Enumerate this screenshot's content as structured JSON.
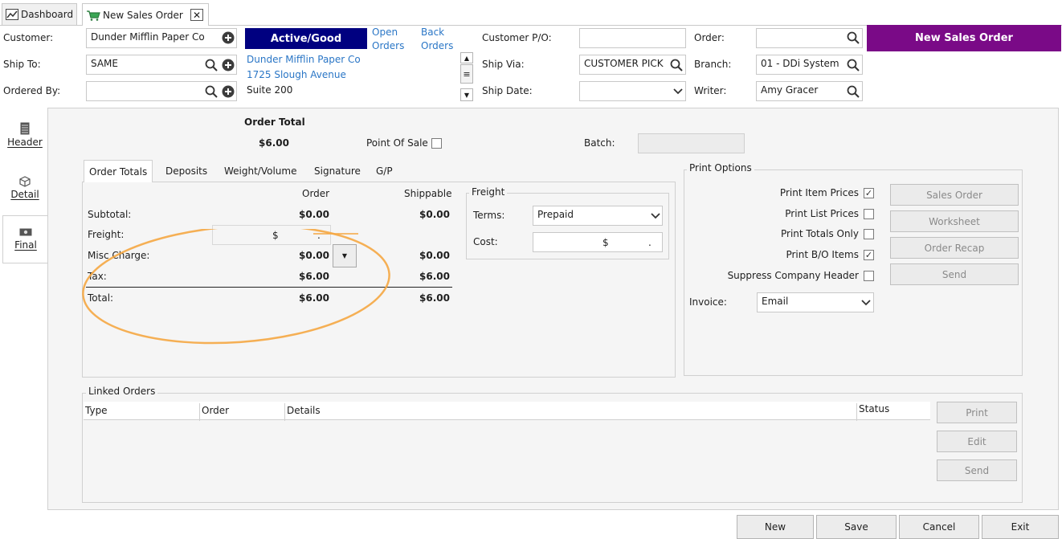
{
  "tabs": [
    {
      "label": "Dashboard"
    },
    {
      "label": "New Sales Order"
    }
  ],
  "header": {
    "customer_label": "Customer:",
    "customer_value": "Dunder Mifflin Paper Co",
    "shipto_label": "Ship To:",
    "shipto_value": "SAME",
    "orderedby_label": "Ordered By:",
    "orderedby_value": "",
    "status_badge": "Active/Good",
    "open_orders": [
      "Open",
      "Orders"
    ],
    "back_orders": [
      "Back",
      "Orders"
    ],
    "address": [
      "Dunder Mifflin Paper Co",
      "1725 Slough Avenue",
      "Suite 200"
    ],
    "customer_po_label": "Customer P/O:",
    "customer_po_value": "",
    "shipvia_label": "Ship Via:",
    "shipvia_value": "CUSTOMER PICK",
    "shipdate_label": "Ship Date:",
    "shipdate_value": "",
    "order_label": "Order:",
    "order_value": "",
    "branch_label": "Branch:",
    "branch_value": "01 - DDi System",
    "writer_label": "Writer:",
    "writer_value": "Amy Gracer",
    "title_banner": "New Sales Order",
    "colors": {
      "status_bg": "#000080",
      "banner_bg": "#7a0a87",
      "link": "#2a76c6",
      "highlight_ring": "#f5a742"
    }
  },
  "sidebar": {
    "items": [
      {
        "label": "Header",
        "icon": "document-icon"
      },
      {
        "label": "Detail",
        "icon": "cube-icon"
      },
      {
        "label": "Final",
        "icon": "money-icon"
      }
    ]
  },
  "summary": {
    "order_total_label": "Order Total",
    "order_total_value": "$6.00",
    "pos_label": "Point Of Sale",
    "pos_checked": false,
    "batch_label": "Batch:",
    "batch_value": ""
  },
  "inner_tabs": [
    "Order Totals",
    "Deposits",
    "Weight/Volume",
    "Signature",
    "G/P"
  ],
  "totals": {
    "col_order": "Order",
    "col_shippable": "Shippable",
    "rows": [
      {
        "label": "Subtotal:",
        "order": "$0.00",
        "shippable": "$0.00"
      },
      {
        "label": "Freight:",
        "order": "$",
        "order_suffix": ".",
        "shippable": ""
      },
      {
        "label": "Misc Charge:",
        "order": "$0.00",
        "shippable": "$0.00"
      },
      {
        "label": "Tax:",
        "order": "$6.00",
        "shippable": "$6.00"
      },
      {
        "label": "Total:",
        "order": "$6.00",
        "shippable": "$6.00"
      }
    ]
  },
  "freight": {
    "title": "Freight",
    "terms_label": "Terms:",
    "terms_value": "Prepaid",
    "cost_label": "Cost:",
    "cost_currency": "$",
    "cost_suffix": "."
  },
  "print_options": {
    "title": "Print Options",
    "options": [
      {
        "label": "Print Item Prices",
        "checked": true
      },
      {
        "label": "Print List Prices",
        "checked": false
      },
      {
        "label": "Print Totals Only",
        "checked": false
      },
      {
        "label": "Print B/O Items",
        "checked": true
      },
      {
        "label": "Suppress Company Header",
        "checked": false
      }
    ],
    "buttons": [
      "Sales Order",
      "Worksheet",
      "Order Recap",
      "Send"
    ],
    "invoice_label": "Invoice:",
    "invoice_value": "Email"
  },
  "linked_orders": {
    "title": "Linked Orders",
    "columns": [
      "Type",
      "Order",
      "Details",
      "Status"
    ],
    "buttons": [
      "Print",
      "Edit",
      "Send"
    ]
  },
  "footer": {
    "buttons": [
      "New",
      "Save",
      "Cancel",
      "Exit"
    ]
  }
}
